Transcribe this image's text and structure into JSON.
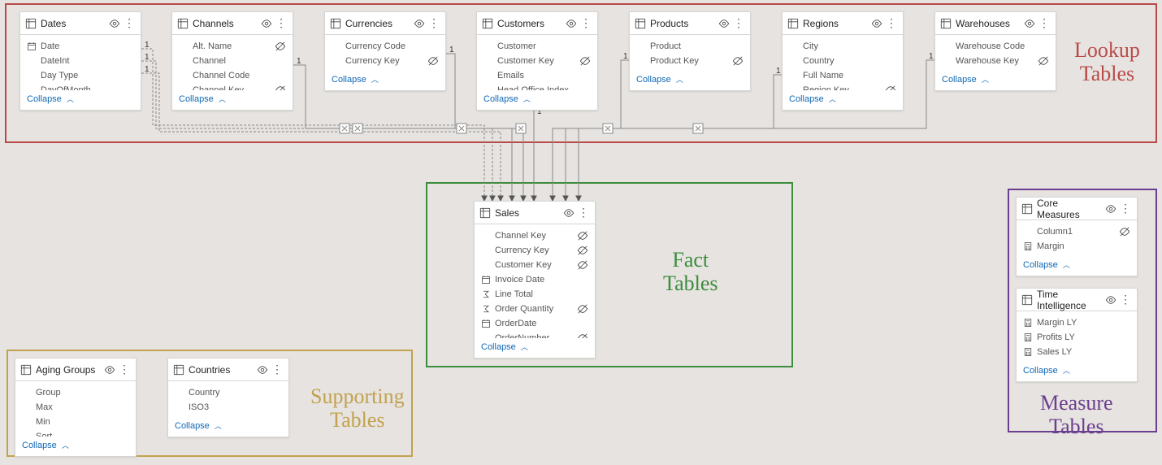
{
  "labels": {
    "lookup": "Lookup\nTables",
    "fact": "Fact\nTables",
    "supporting": "Supporting\nTables",
    "measure": "Measure\nTables",
    "collapse": "Collapse"
  },
  "cards": {
    "dates": {
      "title": "Dates",
      "fields": [
        {
          "n": "Date",
          "icon": "cal"
        },
        {
          "n": "DateInt"
        },
        {
          "n": "Day Type"
        },
        {
          "n": "DayOfMonth"
        }
      ]
    },
    "channels": {
      "title": "Channels",
      "fields": [
        {
          "n": "Alt. Name",
          "hidden": true
        },
        {
          "n": "Channel"
        },
        {
          "n": "Channel Code"
        },
        {
          "n": "Channel Key",
          "hidden": true
        }
      ]
    },
    "currencies": {
      "title": "Currencies",
      "fields": [
        {
          "n": "Currency Code"
        },
        {
          "n": "Currency Key",
          "hidden": true
        }
      ]
    },
    "customers": {
      "title": "Customers",
      "fields": [
        {
          "n": "Customer"
        },
        {
          "n": "Customer Key",
          "hidden": true
        },
        {
          "n": "Emails"
        },
        {
          "n": "Head Office Index"
        }
      ]
    },
    "products": {
      "title": "Products",
      "fields": [
        {
          "n": "Product"
        },
        {
          "n": "Product Key",
          "hidden": true
        }
      ]
    },
    "regions": {
      "title": "Regions",
      "fields": [
        {
          "n": "City"
        },
        {
          "n": "Country"
        },
        {
          "n": "Full Name"
        },
        {
          "n": "Region Key",
          "hidden": true
        }
      ]
    },
    "warehouses": {
      "title": "Warehouses",
      "fields": [
        {
          "n": "Warehouse Code"
        },
        {
          "n": "Warehouse Key",
          "hidden": true
        }
      ]
    },
    "sales": {
      "title": "Sales",
      "fields": [
        {
          "n": "Channel Key",
          "hidden": true
        },
        {
          "n": "Currency Key",
          "hidden": true
        },
        {
          "n": "Customer Key",
          "hidden": true
        },
        {
          "n": "Invoice Date",
          "icon": "cal"
        },
        {
          "n": "Line Total",
          "icon": "sum"
        },
        {
          "n": "Order Quantity",
          "icon": "sum",
          "hidden": true
        },
        {
          "n": "OrderDate",
          "icon": "cal"
        },
        {
          "n": "OrderNumber",
          "hidden": true
        }
      ]
    },
    "aging": {
      "title": "Aging Groups",
      "fields": [
        {
          "n": "Group"
        },
        {
          "n": "Max"
        },
        {
          "n": "Min"
        },
        {
          "n": "Sort"
        }
      ]
    },
    "countries": {
      "title": "Countries",
      "fields": [
        {
          "n": "Country"
        },
        {
          "n": "ISO3"
        }
      ]
    },
    "core": {
      "title": "Core Measures",
      "fields": [
        {
          "n": "Column1",
          "hidden": true
        },
        {
          "n": "Margin",
          "icon": "calc"
        }
      ]
    },
    "ti": {
      "title": "Time Intelligence",
      "fields": [
        {
          "n": "Margin LY",
          "icon": "calc"
        },
        {
          "n": "Profits LY",
          "icon": "calc"
        },
        {
          "n": "Sales LY",
          "icon": "calc"
        }
      ]
    }
  }
}
